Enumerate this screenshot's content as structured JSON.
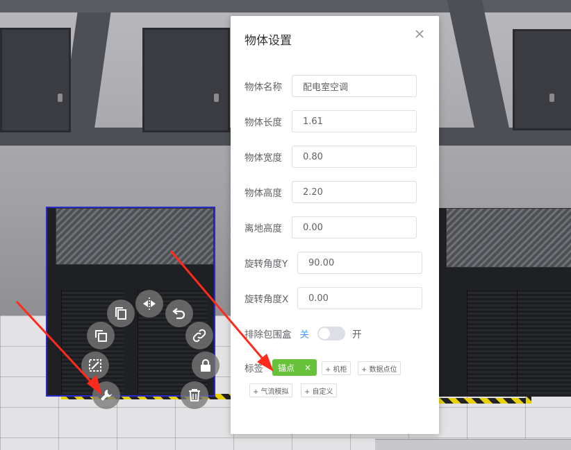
{
  "modal": {
    "title": "物体设置",
    "close_icon": "close-icon",
    "fields": [
      {
        "label": "物体名称",
        "value": "配电室空调"
      },
      {
        "label": "物体长度",
        "value": "1.61"
      },
      {
        "label": "物体宽度",
        "value": "0.80"
      },
      {
        "label": "物体高度",
        "value": "2.20"
      },
      {
        "label": "离地高度",
        "value": "0.00"
      },
      {
        "label": "旋转角度Y",
        "value": "90.00"
      },
      {
        "label": "旋转角度X",
        "value": "0.00"
      }
    ],
    "toggle": {
      "label": "排除包围盒",
      "off_text": "关",
      "on_text": "开",
      "state": "off"
    },
    "tags": {
      "label": "标签",
      "active": {
        "text": "锚点",
        "remove": "×"
      },
      "add_options": [
        "+ 机柜",
        "+ 数据点位",
        "+ 气流模拟",
        "+ 自定义"
      ]
    }
  },
  "ring_tools": [
    "copy-icon",
    "mirror-icon",
    "undo-icon",
    "duplicate-icon",
    "link-icon",
    "select-box-icon",
    "lock-icon",
    "wrench-icon",
    "trash-icon"
  ],
  "colors": {
    "accent": "#409eff",
    "tag_active": "#67c23a",
    "arrow": "#ff2a1a",
    "selection": "#2a2ad0"
  }
}
